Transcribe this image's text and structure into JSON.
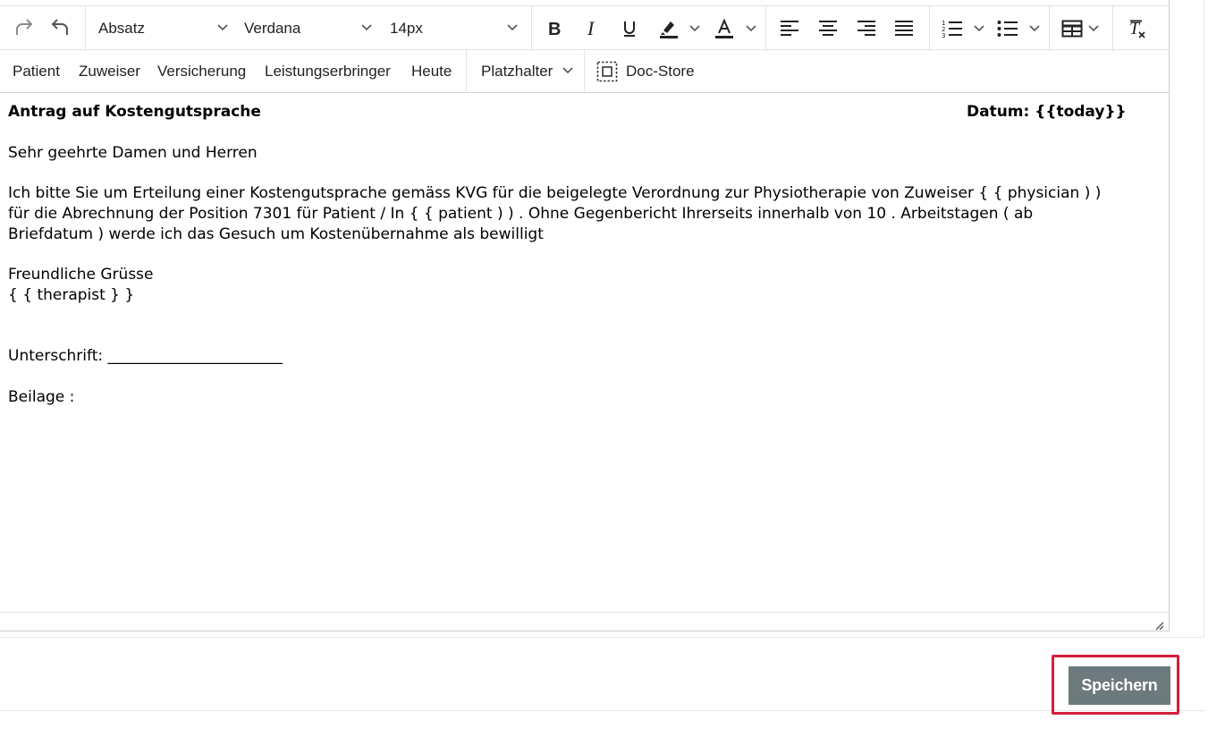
{
  "toolbar": {
    "block_format": "Absatz",
    "font_family": "Verdana",
    "font_size": "14px",
    "icons": [
      "redo-icon",
      "undo-icon",
      "bold-icon",
      "italic-icon",
      "underline-icon",
      "highlight-color-icon",
      "text-color-icon",
      "align-left-icon",
      "align-center-icon",
      "align-right-icon",
      "align-justify-icon",
      "numbered-list-icon",
      "bullet-list-icon",
      "table-icon",
      "clear-formatting-icon"
    ]
  },
  "menubar": {
    "patient": "Patient",
    "zuweiser": "Zuweiser",
    "versicherung": "Versicherung",
    "leistungserbringer": "Leistungserbringer",
    "heute": "Heute",
    "platzhalter": "Platzhalter",
    "docstore": "Doc-Store"
  },
  "document": {
    "title": "Antrag auf Kostengutsprache",
    "date": "Datum: {{today}}",
    "salutation": "Sehr geehrte Damen und Herren",
    "body_line1": "Ich bitte Sie um Erteilung einer Kostengutsprache gemäss KVG für die beigelegte Verordnung zur Physiotherapie von Zuweiser { { physician ) )",
    "body_line2": "für die Abrechnung der Position 7301 für Patient / In { { patient ) ) . Ohne Gegenbericht Ihrerseits innerhalb von 10 . Arbeitstagen ( ab",
    "body_line3": "Briefdatum ) werde ich das Gesuch um Kostenübernahme als bewilligt",
    "closing": "Freundliche Grüsse",
    "therapist": "{ { therapist } }",
    "signature": "Unterschrift: _______________________",
    "attachment": "Beilage :"
  },
  "footer": {
    "save_label": "Speichern"
  },
  "colors": {
    "save_button": "#6c7a7e",
    "highlight_border": "#d3203a"
  }
}
